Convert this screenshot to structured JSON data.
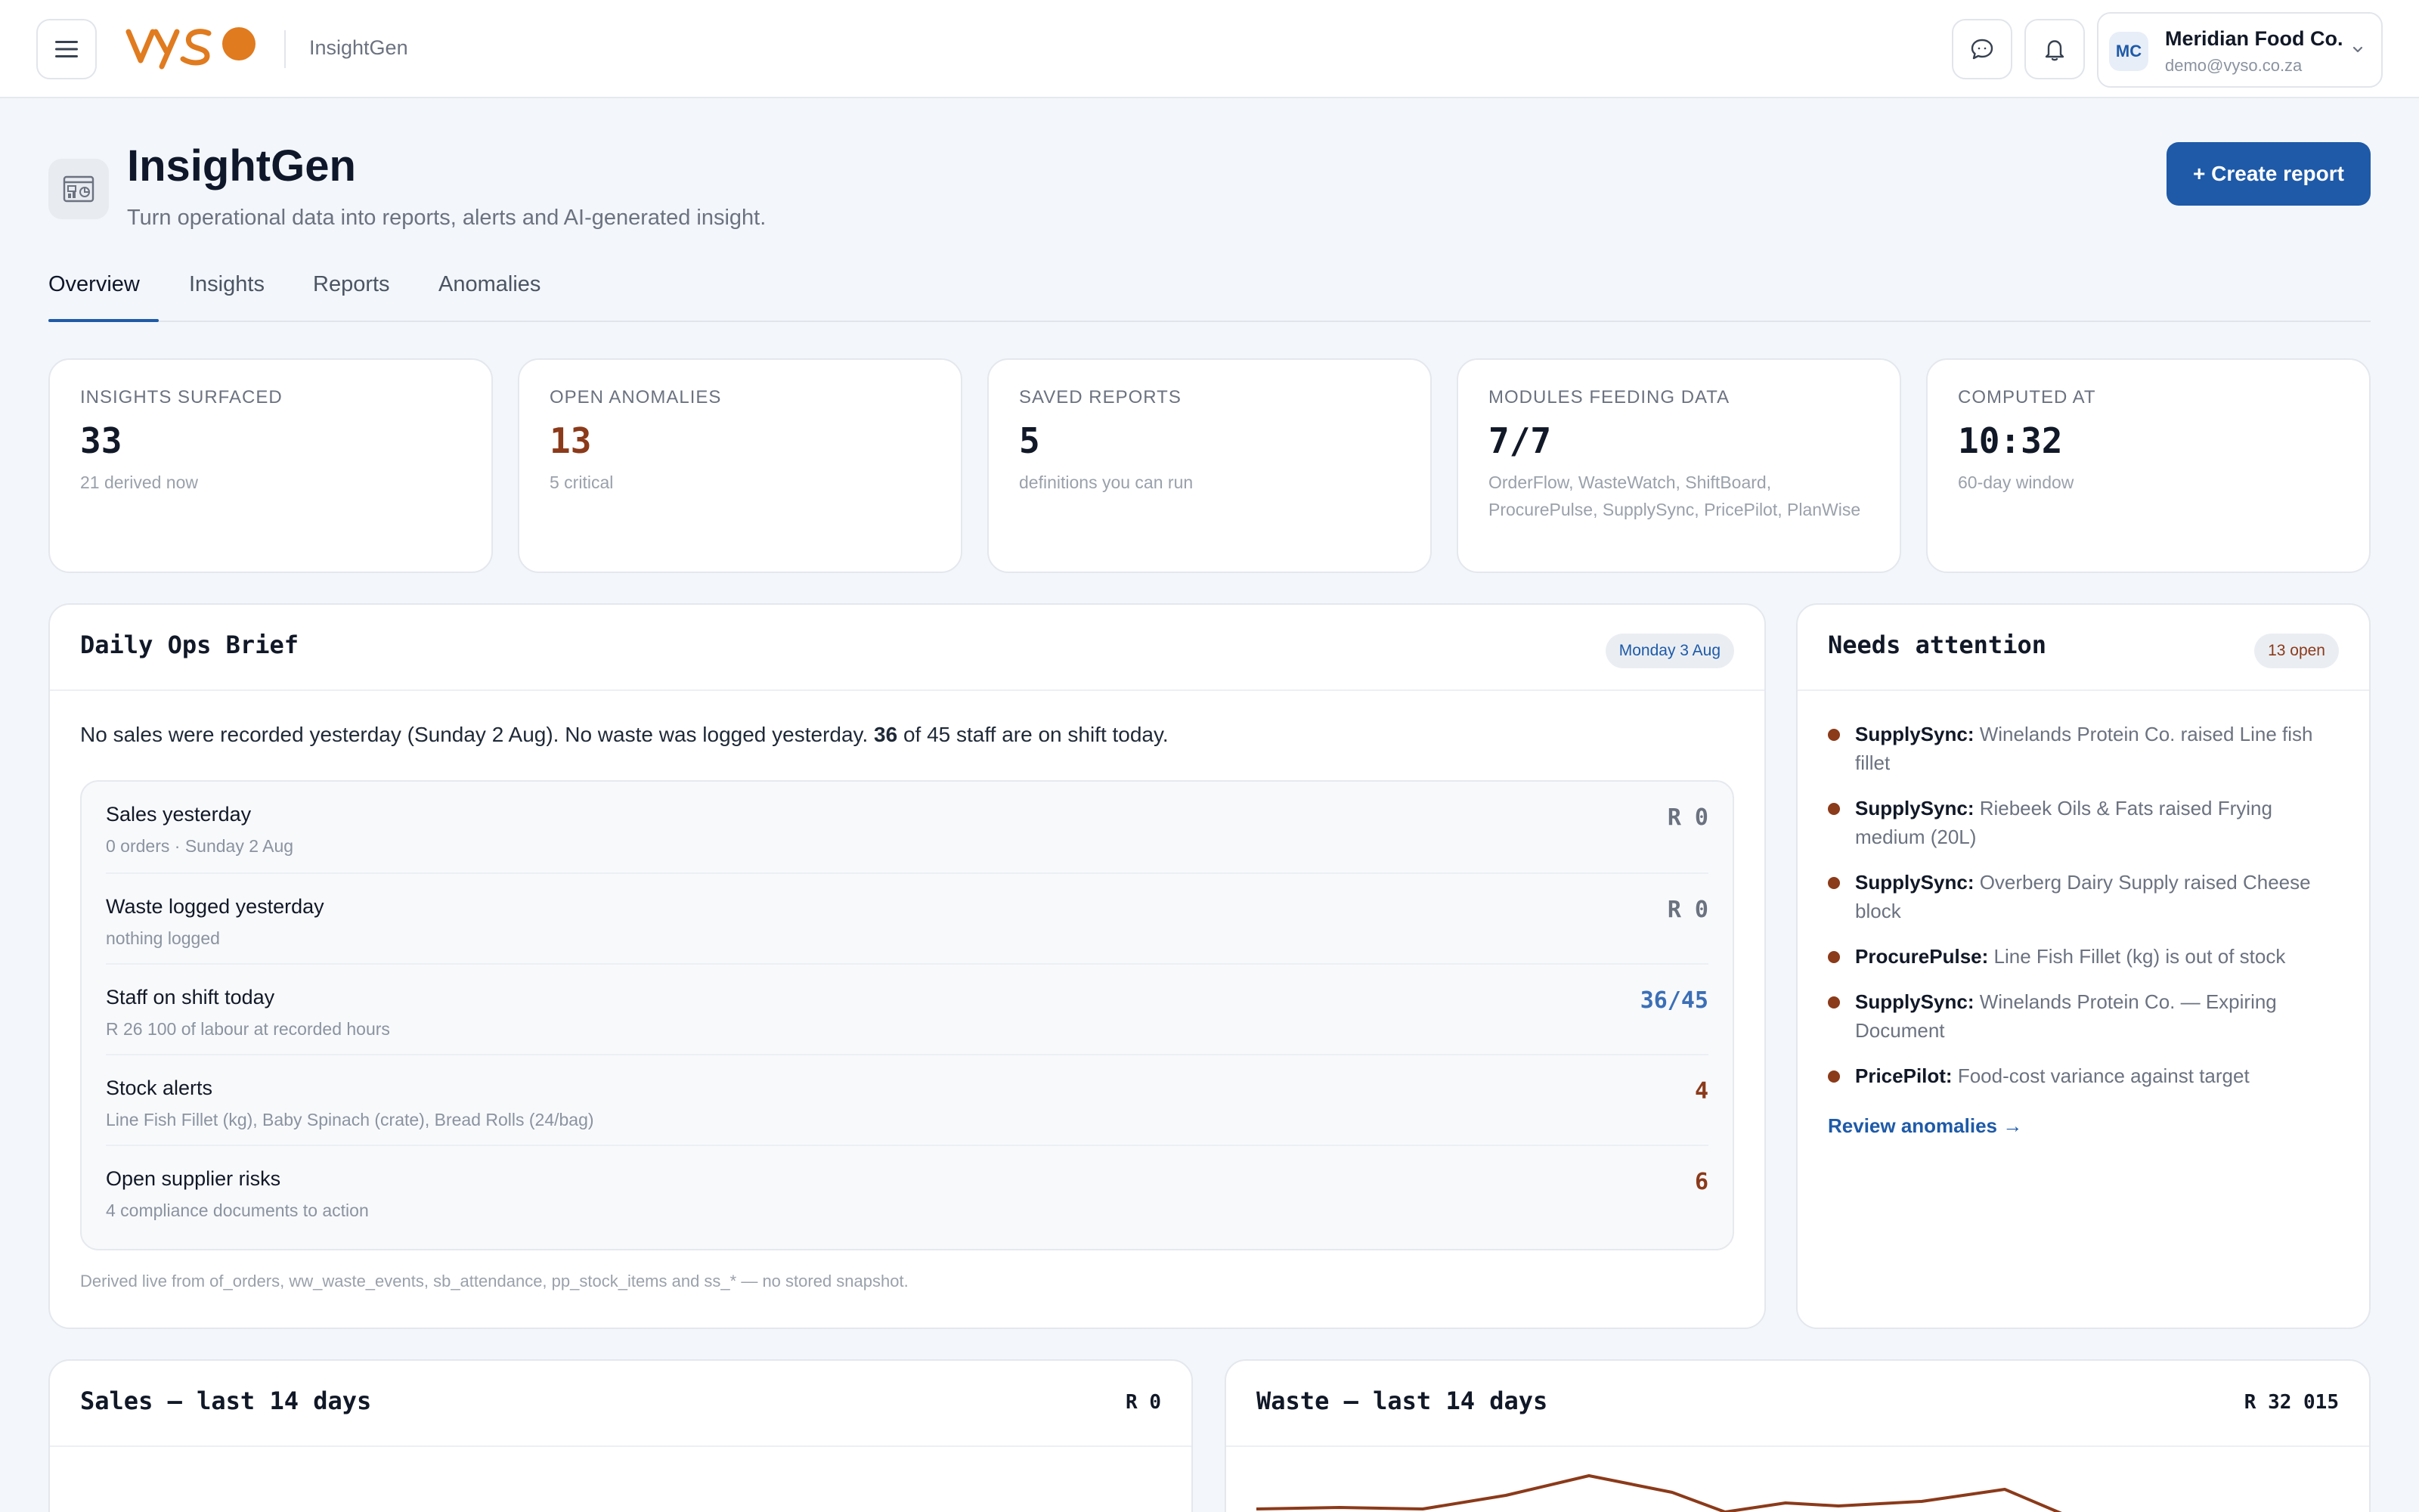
{
  "header": {
    "app_name": "InsightGen",
    "account": {
      "initials": "MC",
      "name": "Meridian Food Co.",
      "email": "demo@vyso.co.za"
    }
  },
  "page": {
    "title": "InsightGen",
    "subtitle": "Turn operational data into reports, alerts and AI-generated insight.",
    "create_button": "+ Create report"
  },
  "tabs": [
    {
      "label": "Overview",
      "active": true
    },
    {
      "label": "Insights",
      "active": false
    },
    {
      "label": "Reports",
      "active": false
    },
    {
      "label": "Anomalies",
      "active": false
    }
  ],
  "stats": [
    {
      "label": "INSIGHTS SURFACED",
      "value": "33",
      "sub": "21 derived now"
    },
    {
      "label": "OPEN ANOMALIES",
      "value": "13",
      "sub": "5 critical",
      "color": "#8b3a1a"
    },
    {
      "label": "SAVED REPORTS",
      "value": "5",
      "sub": "definitions you can run"
    },
    {
      "label": "MODULES FEEDING DATA",
      "value": "7/7",
      "sub": "OrderFlow, WasteWatch, ShiftBoard, ProcurePulse, SupplySync, PricePilot, PlanWise"
    },
    {
      "label": "COMPUTED AT",
      "value": "10:32",
      "sub": "60-day window"
    }
  ],
  "brief": {
    "title": "Daily Ops Brief",
    "date_pill": "Monday 3 Aug",
    "summary_before": "No sales were recorded yesterday (Sunday 2 Aug). No waste was logged yesterday. ",
    "summary_bold": "36",
    "summary_after": " of 45 staff are on shift today.",
    "rows": [
      {
        "title": "Sales yesterday",
        "sub": "0 orders · Sunday 2 Aug",
        "value": "R 0",
        "color": "#6b7280"
      },
      {
        "title": "Waste logged yesterday",
        "sub": "nothing logged",
        "value": "R 0",
        "color": "#6b7280"
      },
      {
        "title": "Staff on shift today",
        "sub": "R 26 100 of labour at recorded hours",
        "value": "36/45",
        "color": "#3b6fb6"
      },
      {
        "title": "Stock alerts",
        "sub": "Line Fish Fillet (kg), Baby Spinach (crate), Bread Rolls (24/bag)",
        "value": "4",
        "color": "#8b3a1a"
      },
      {
        "title": "Open supplier risks",
        "sub": "4 compliance documents to action",
        "value": "6",
        "color": "#8b3a1a"
      }
    ],
    "footnote": "Derived live from of_orders, ww_waste_events, sb_attendance, pp_stock_items and ss_* — no stored snapshot."
  },
  "attention": {
    "title": "Needs attention",
    "count_pill": "13 open",
    "items": [
      {
        "source": "SupplySync:",
        "text": " Winelands Protein Co. raised Line fish fillet"
      },
      {
        "source": "SupplySync:",
        "text": " Riebeek Oils & Fats raised Frying medium (20L)"
      },
      {
        "source": "SupplySync:",
        "text": " Overberg Dairy Supply raised Cheese block"
      },
      {
        "source": "ProcurePulse:",
        "text": " Line Fish Fillet (kg) is out of stock"
      },
      {
        "source": "SupplySync:",
        "text": " Winelands Protein Co. — Expiring Document"
      },
      {
        "source": "PricePilot:",
        "text": " Food-cost variance against target"
      }
    ],
    "link": "Review anomalies →"
  },
  "sales_chart": {
    "title": "Sales — last 14 days",
    "total": "R 0"
  },
  "waste_chart": {
    "title": "Waste — last 14 days",
    "total": "R 32 015"
  },
  "colors": {
    "accent": "#1e5aa8",
    "alert": "#8b3a1a",
    "logo": "#e07b1f"
  },
  "icons": [
    "menu-icon",
    "chat-icon",
    "bell-icon",
    "chevron-down-icon",
    "report-icon"
  ]
}
